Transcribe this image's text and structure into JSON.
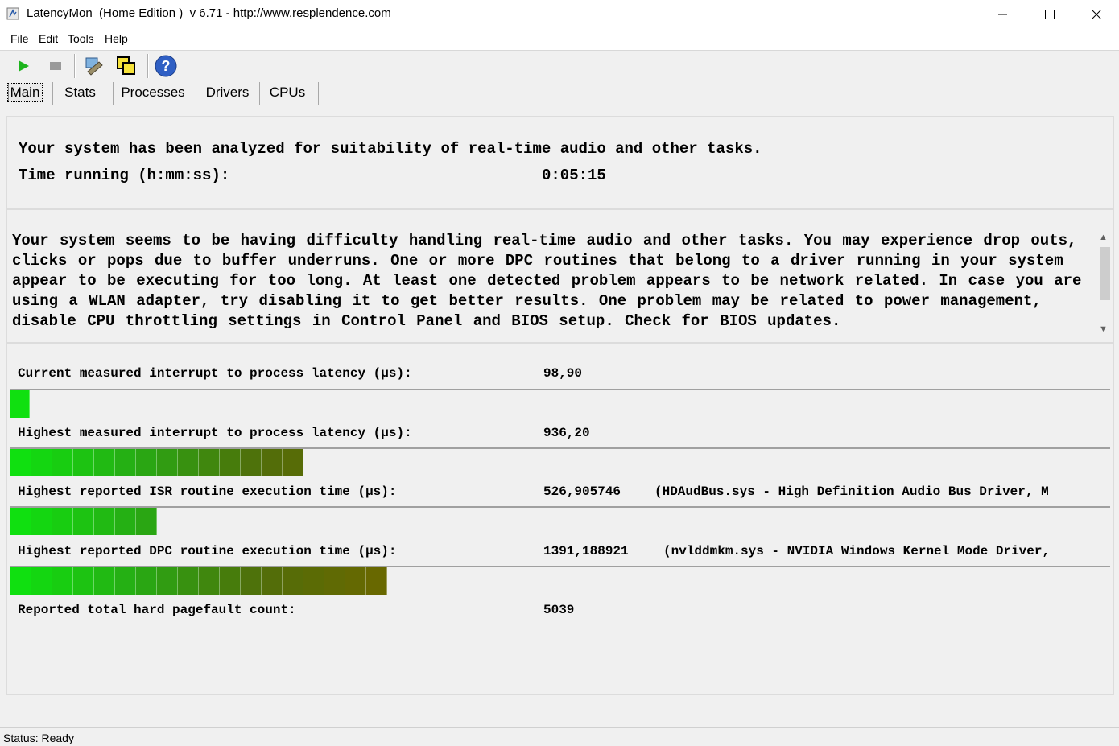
{
  "window": {
    "title": "LatencyMon  (Home Edition )  v 6.71 - http://www.resplendence.com",
    "app_icon": "latencymon-icon"
  },
  "menu": [
    {
      "label": "File"
    },
    {
      "label": "Edit"
    },
    {
      "label": "Tools"
    },
    {
      "label": "Help"
    }
  ],
  "toolbar": {
    "buttons": [
      "play-icon",
      "stop-icon",
      "network-icon",
      "copy-icon",
      "help-icon"
    ]
  },
  "tabs": [
    {
      "label": "Main",
      "active": true
    },
    {
      "label": "Stats"
    },
    {
      "label": "Processes"
    },
    {
      "label": "Drivers"
    },
    {
      "label": "CPUs"
    }
  ],
  "summary": {
    "analyzed": "Your system has been analyzed for suitability of real-time audio and other tasks.",
    "time_label": "Time running (h:mm:ss):",
    "time_value": "0:05:15"
  },
  "message": "Your system seems to be having difficulty handling real-time audio and other tasks. You may experience drop outs, clicks or pops due to buffer underruns. One or more DPC routines that belong to a driver running in your system appear to be executing for too long. At least one detected problem appears to be network related. In case you are using a WLAN adapter, try disabling it to get better results. One problem may be related to power management, disable CPU throttling settings in Control Panel and BIOS setup. Check for BIOS updates.",
  "metrics": [
    {
      "label": "Current measured interrupt to process latency (µs):",
      "value": "98,90",
      "detail": "",
      "bar_segments": 1
    },
    {
      "label": "Highest measured interrupt to process latency (µs):",
      "value": "936,20",
      "detail": "",
      "bar_segments": 14
    },
    {
      "label": "Highest reported ISR routine execution time (µs):",
      "value": "526,905746",
      "detail": "(HDAudBus.sys - High Definition Audio Bus Driver, M",
      "bar_segments": 7
    },
    {
      "label": "Highest reported DPC routine execution time (µs):",
      "value": "1391,188921",
      "detail": "(nvlddmkm.sys - NVIDIA Windows Kernel Mode Driver,",
      "bar_segments": 18
    }
  ],
  "pagefault": {
    "label": "Reported total hard pagefault count:",
    "value": "5039"
  },
  "status": "Status: Ready"
}
